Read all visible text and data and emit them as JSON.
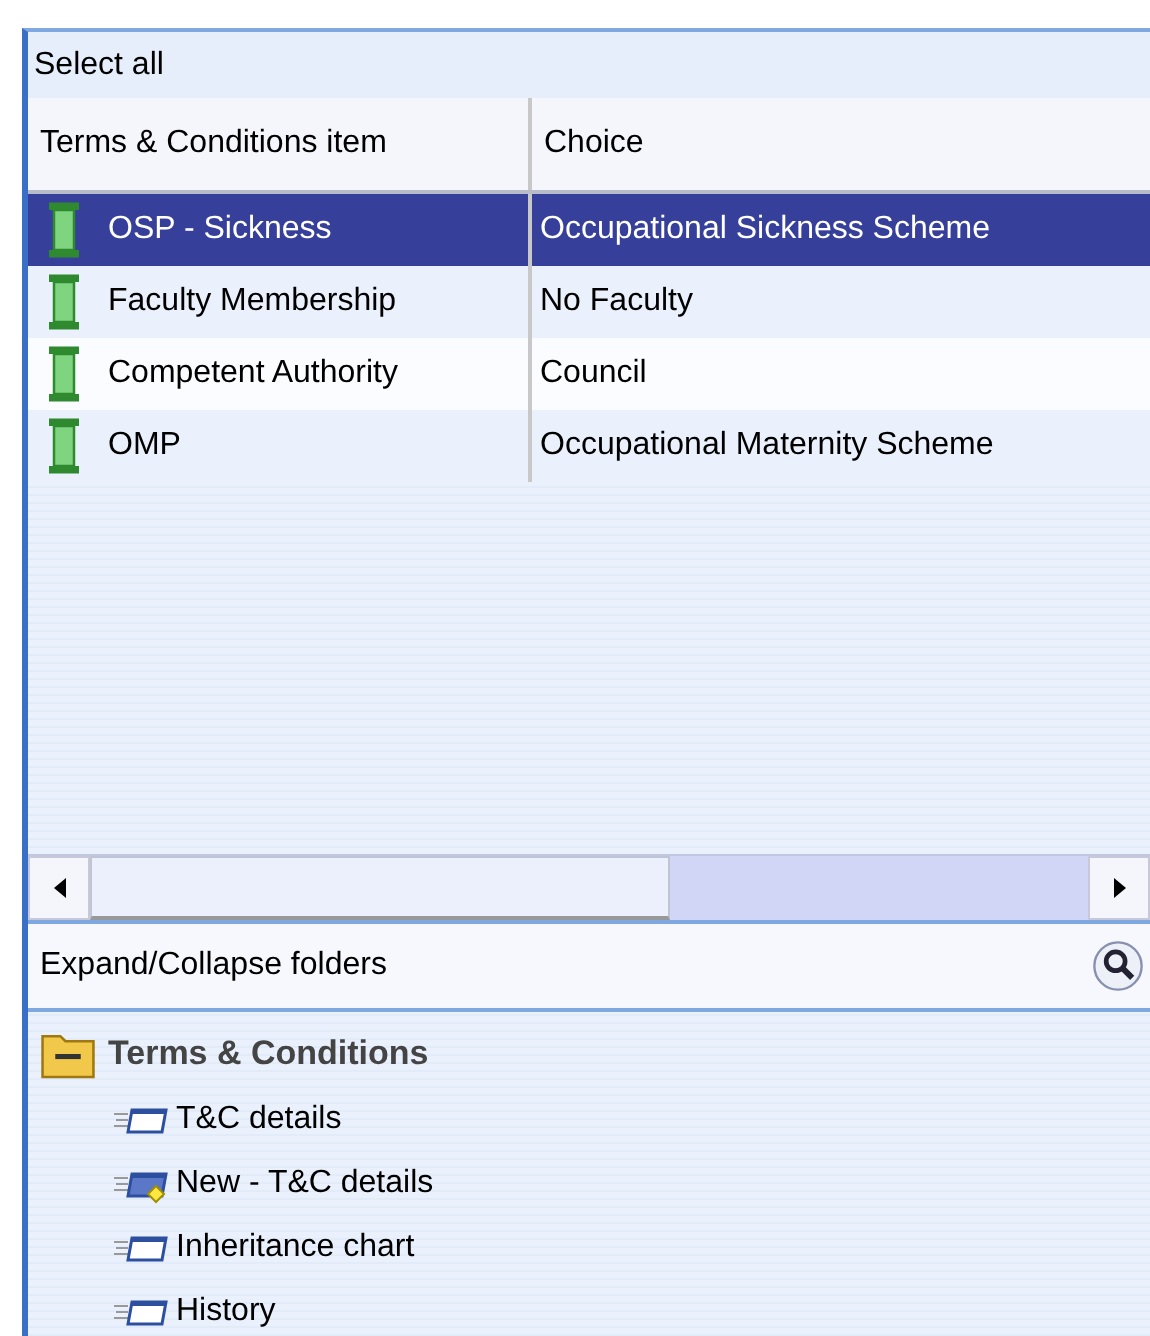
{
  "select_all": {
    "label": "Select all"
  },
  "table": {
    "columns": [
      "Terms & Conditions item",
      "Choice"
    ],
    "rows": [
      {
        "item": "OSP - Sickness",
        "choice": "Occupational Sickness Scheme",
        "selected": true
      },
      {
        "item": "Faculty Membership",
        "choice": "No Faculty",
        "selected": false
      },
      {
        "item": "Competent Authority",
        "choice": "Council",
        "selected": false
      },
      {
        "item": "OMP",
        "choice": "Occupational Maternity Scheme",
        "selected": false
      }
    ]
  },
  "folders_bar": {
    "label": "Expand/Collapse folders"
  },
  "tree": [
    {
      "label": "Terms & Conditions",
      "expanded": true,
      "children": [
        {
          "label": "T&C details",
          "kind": "form"
        },
        {
          "label": "New - T&C details",
          "kind": "new"
        },
        {
          "label": "Inheritance chart",
          "kind": "form"
        },
        {
          "label": "History",
          "kind": "form"
        }
      ]
    }
  ]
}
